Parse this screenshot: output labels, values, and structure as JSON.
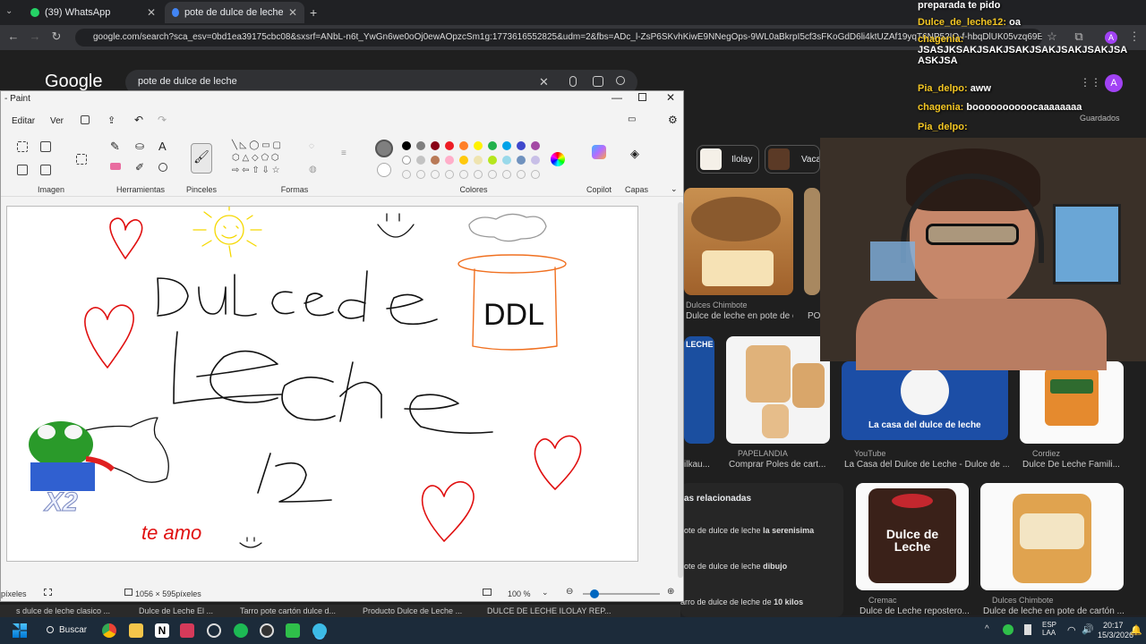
{
  "browser": {
    "tabs": [
      {
        "label": "(39) WhatsApp",
        "active": false
      },
      {
        "label": "pote de dulce de leche - Busca",
        "active": true
      }
    ],
    "url": "google.com/search?sca_esv=0bd1ea39175cbc08&sxsrf=ANbL-n6t_YwGn6we0oOj0ewAOpzcSm1g:1773616552825&udm=2&fbs=ADc_l-ZsP6SKvhKiwE9NNegOps-9WL0aBkrpI5cf3sFKoGdD6li4ktUZAf19yqT6NP52IQ-f-hbqDlUK05vzq69ERLHzGNVihi..."
  },
  "google": {
    "logo": "Google",
    "query": "pote de dulce de leche",
    "saved_label": "Guardados",
    "chips": [
      {
        "label": "Ilolay"
      },
      {
        "label": "Vaca"
      }
    ],
    "results": [
      {
        "source": "Dulces Chimbote",
        "caption": "Dulce de leche en pote de car..."
      },
      {
        "source": "PAPELANDIA",
        "caption": "Comprar Poles de cart..."
      },
      {
        "source": "YouTube",
        "caption": "La Casa del Dulce de Leche - Dulce de ..."
      },
      {
        "source": "Cordiez",
        "caption": "Dulce De Leche Famili..."
      },
      {
        "source": "Cremac",
        "caption": "Dulce de Leche repostero..."
      },
      {
        "source": "Dulces Chimbote",
        "caption": "Dulce de leche en pote de cartón ..."
      }
    ],
    "related_title": "as relacionadas",
    "related": [
      {
        "prefix": "ote de dulce de leche ",
        "bold": "la serenisima"
      },
      {
        "prefix": "ote de dulce de leche ",
        "bold": "dibujo"
      },
      {
        "prefix": "arro de dulce de leche de ",
        "bold": "10 kilos"
      }
    ],
    "bottom_tabs": [
      "s dulce de leche clasico ...",
      "Dulce de Leche El ...",
      "Tarro pote cartón dulce d...",
      "Producto Dulce de Leche ...",
      "DULCE DE LECHE ILOLAY REP..."
    ]
  },
  "paint": {
    "title": "- Paint",
    "menu": [
      "Editar",
      "Ver"
    ],
    "groups": [
      "Imagen",
      "Herramientas",
      "Pinceles",
      "Formas",
      "Colores",
      "Copilot",
      "Capas"
    ],
    "colors": [
      "#000000",
      "#7f7f7f",
      "#880015",
      "#ed1c24",
      "#ff7f27",
      "#fff200",
      "#22b14c",
      "#00a2e8",
      "#3f48cc",
      "#a349a4",
      "#ffffff",
      "#c3c3c3",
      "#b97a57",
      "#ffaec9",
      "#ffc90e",
      "#efe4b0",
      "#b5e61d",
      "#99d9ea",
      "#7092be",
      "#c8bfe7"
    ],
    "drawing": {
      "title_lines": [
        "DULCe de",
        "leche",
        "12"
      ],
      "jar_label": "DDL",
      "bottom_note": "te amo",
      "emote_badge": "X2"
    },
    "status": {
      "units": "píxeles",
      "size": "1056 × 595píxeles",
      "zoom": "100 %"
    }
  },
  "chat": [
    {
      "user": "",
      "text": "preparada te pido"
    },
    {
      "user": "Dulce_de_leche12:",
      "text": "oa"
    },
    {
      "user": "chagenia:",
      "text": "JSASJKSAKJSAKJSAKJSAKJSAKJSAKJSA ASKJSA"
    },
    {
      "user": "Pia_delpo:",
      "text": "aww"
    },
    {
      "user": "chagenia:",
      "text": "boooooooooocaaaaaaaa"
    },
    {
      "user": "Pia_delpo:",
      "text": ""
    }
  ],
  "taskbar": {
    "search": "Buscar",
    "lang": "ESP\nLAA",
    "time": "20:17",
    "date": "15/3/2026"
  }
}
